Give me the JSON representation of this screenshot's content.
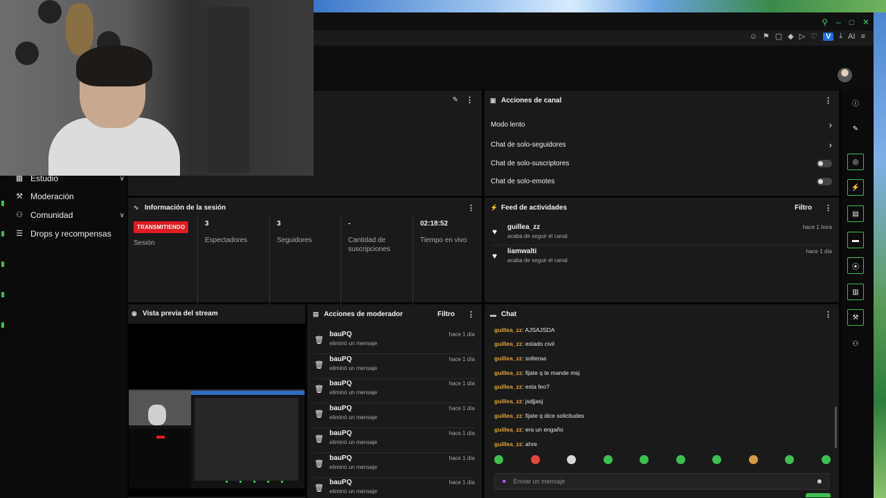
{
  "sidebar": {
    "items": [
      {
        "label": "Estudio",
        "icon": "studio-icon",
        "has_chevron": true
      },
      {
        "label": "Moderación",
        "icon": "wrench-icon",
        "has_chevron": false
      },
      {
        "label": "Comunidad",
        "icon": "community-icon",
        "has_chevron": true
      },
      {
        "label": "Drops y recompensas",
        "icon": "drops-icon",
        "has_chevron": false
      }
    ]
  },
  "browser": {
    "extensions_label": "AI",
    "profile_letter": "V"
  },
  "channel_actions": {
    "title": "Acciones de canal",
    "rows": [
      {
        "label": "Modo lento",
        "control": "arrow"
      },
      {
        "label": "Chat de solo-seguidores",
        "control": "arrow"
      },
      {
        "label": "Chat de solo-suscriptores",
        "control": "toggle",
        "on": false
      },
      {
        "label": "Chat de solo-emotes",
        "control": "toggle",
        "on": false
      }
    ]
  },
  "session": {
    "title": "Información de la sesión",
    "live_badge": "TRANSMITIENDO",
    "session_label": "Sesión",
    "stats": [
      {
        "value": "3",
        "label": "Espectadores"
      },
      {
        "value": "3",
        "label": "Seguidores"
      },
      {
        "value": "-",
        "label": "Cantidad de suscripciones"
      },
      {
        "value": "02:18:52",
        "label": "Tiempo en vivo"
      }
    ]
  },
  "activity_feed": {
    "title": "Feed de actividades",
    "filter_label": "Filtro",
    "items": [
      {
        "user": "guillea_zz",
        "action": "acaba de seguir el canal",
        "time": "hace 1 hora"
      },
      {
        "user": "liamwalti",
        "action": "acaba de seguir el canal",
        "time": "hace 1 día"
      }
    ]
  },
  "preview": {
    "title": "Vista previa del stream"
  },
  "mod_actions": {
    "title": "Acciones de moderador",
    "filter_label": "Filtro",
    "items": [
      {
        "user": "bauPQ",
        "action": "eliminó un mensaje",
        "time": "hace 1 día"
      },
      {
        "user": "bauPQ",
        "action": "eliminó un mensaje",
        "time": "hace 1 día"
      },
      {
        "user": "bauPQ",
        "action": "eliminó un mensaje",
        "time": "hace 1 día"
      },
      {
        "user": "bauPQ",
        "action": "eliminó un mensaje",
        "time": "hace 1 día"
      },
      {
        "user": "bauPQ",
        "action": "eliminó un mensaje",
        "time": "hace 1 día"
      },
      {
        "user": "bauPQ",
        "action": "eliminó un mensaje",
        "time": "hace 1 día"
      },
      {
        "user": "bauPQ",
        "action": "eliminó un mensaje",
        "time": "hace 1 día"
      }
    ]
  },
  "chat": {
    "title": "Chat",
    "messages": [
      {
        "user": "guillea_zz",
        "text": "AJSAJSDA"
      },
      {
        "user": "guillea_zz",
        "text": "estado civil"
      },
      {
        "user": "guillea_zz",
        "text": "solteraa"
      },
      {
        "user": "guillea_zz",
        "text": "fijate q te mande msj"
      },
      {
        "user": "guillea_zz",
        "text": "esta feo?"
      },
      {
        "user": "guillea_zz",
        "text": "jsdjjasj"
      },
      {
        "user": "guillea_zz",
        "text": "fijate q dice solicitudes"
      },
      {
        "user": "guillea_zz",
        "text": "era un engaño"
      },
      {
        "user": "guillea_zz",
        "text": "ahre"
      }
    ],
    "input_placeholder": "Enviar un mensaje",
    "emote_count": 10
  },
  "colors": {
    "accent": "#3fbf4f",
    "live": "#e11b22",
    "chat_username": "#e5a23b",
    "panel": "#1a1a1a"
  }
}
